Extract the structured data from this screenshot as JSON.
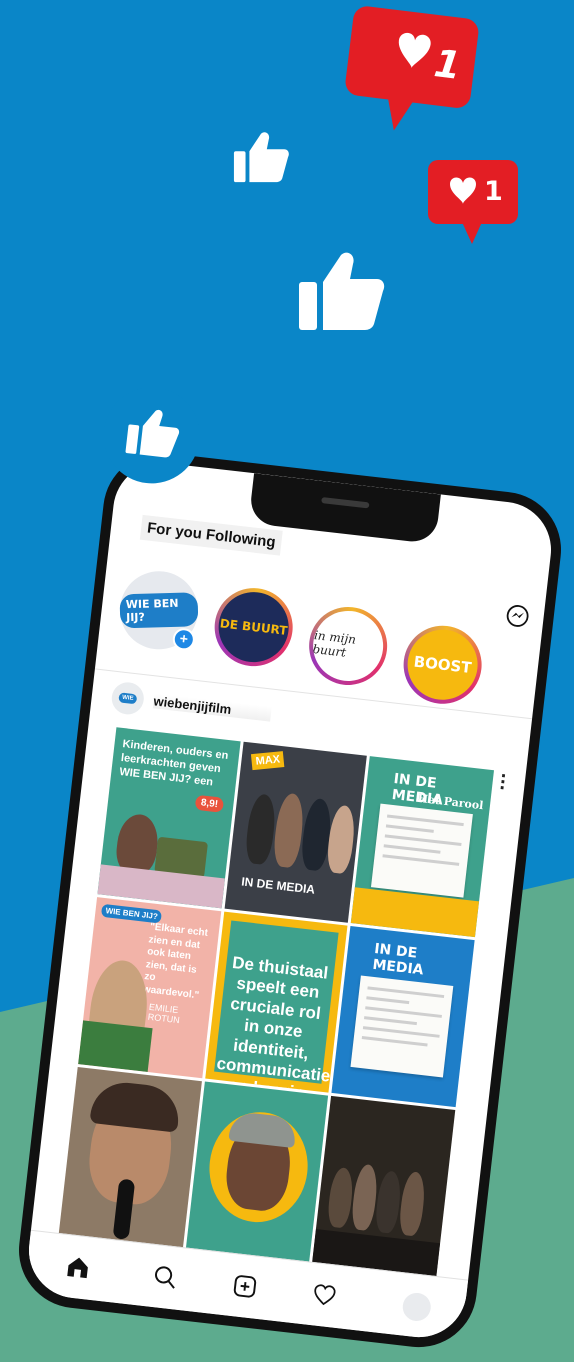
{
  "colors": {
    "background_blue": "#0a86c8",
    "background_green": "#5dab8e",
    "notification_red": "#e31e24",
    "story_yellow": "#f6b90f",
    "brand_blue": "#1e7ec8"
  },
  "notifications": {
    "big_like_count": "1",
    "small_like_count": "1",
    "icon_heart": "heart-icon",
    "icon_thumb": "thumbs-up-icon"
  },
  "header": {
    "tabs_label": "For you Following",
    "messenger_icon": "messenger-icon"
  },
  "stories": [
    {
      "name": "wiebenjijfilm",
      "logo_text": "WIE BEN JIJ?"
    },
    {
      "name": "de-buurt",
      "logo_text": "DE BUURT"
    },
    {
      "name": "in-mijn-buurt",
      "logo_text": "in mijn buurt"
    },
    {
      "name": "boost",
      "logo_text": "BOOST"
    }
  ],
  "post": {
    "username": "wiebenjijfilm",
    "more_icon": "more-vertical-icon",
    "tiles": [
      {
        "text": "Kinderen, ouders en leerkrachten geven WIE BEN JIJ? een",
        "score": "8,9!"
      },
      {
        "text": "IN DE MEDIA",
        "badge": "MAX"
      },
      {
        "text": "IN DE MEDIA",
        "subtitle": "Het Parool"
      },
      {
        "text": "\"Elkaar echt zien en dat ook laten zien, dat is zo waardevol.\"",
        "signature": "EMILIE ROTUN",
        "badge": "WIE BEN JIJ?"
      },
      {
        "text": "De thuistaal speelt een cruciale rol in onze identiteit, communicatie en begrip"
      },
      {
        "text": "IN DE MEDIA"
      },
      {
        "text": ""
      },
      {
        "text": ""
      },
      {
        "text": ""
      }
    ]
  },
  "nav": {
    "items": [
      "home-icon",
      "search-icon",
      "create-icon",
      "activity-icon",
      "profile-avatar"
    ]
  }
}
